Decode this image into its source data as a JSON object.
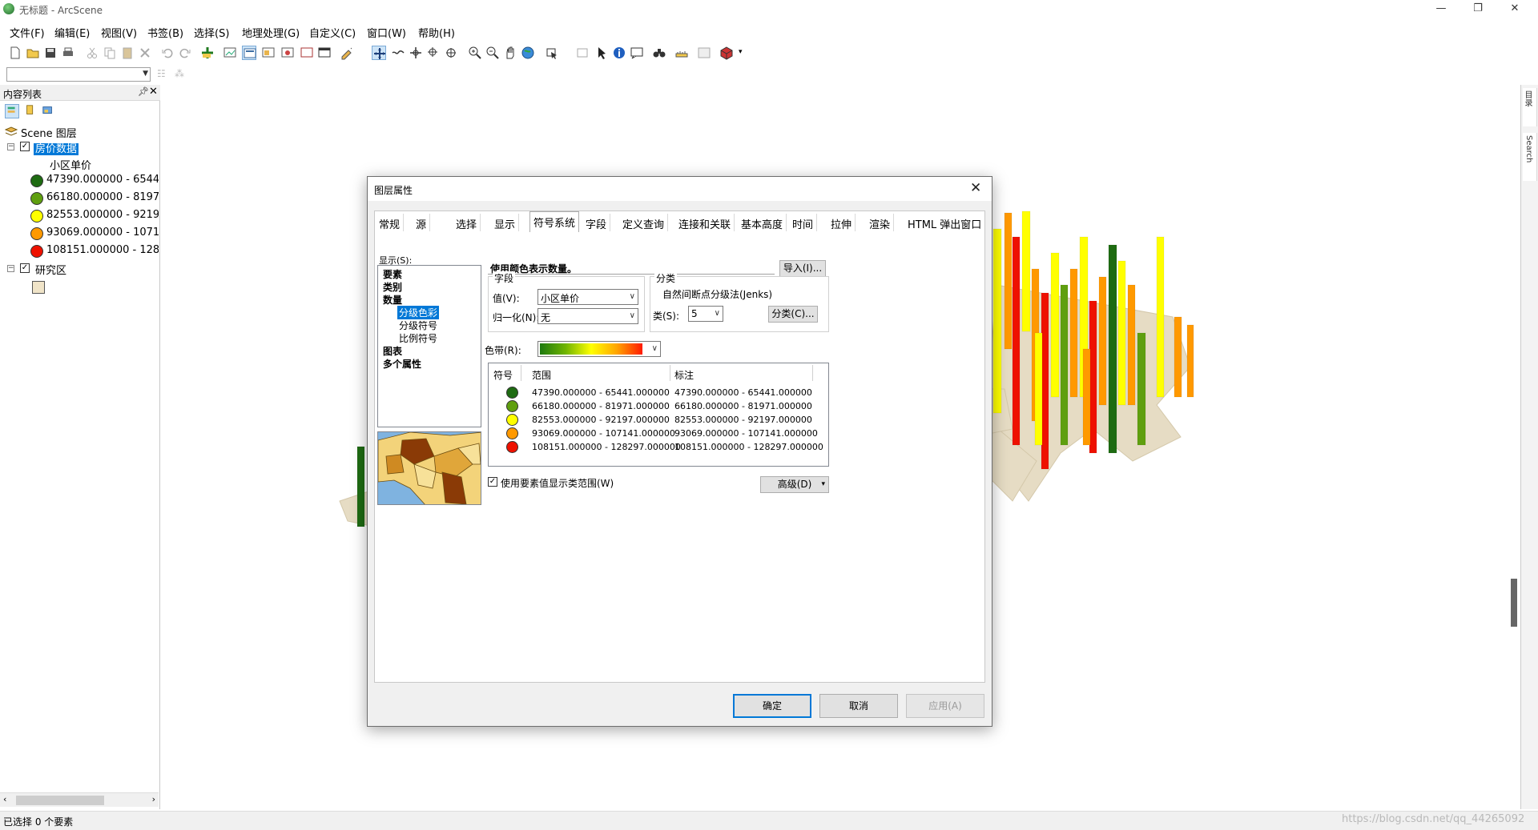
{
  "window": {
    "title": "无标题 - ArcScene"
  },
  "menu": [
    "文件(F)",
    "编辑(E)",
    "视图(V)",
    "书签(B)",
    "选择(S)",
    "地理处理(G)",
    "自定义(C)",
    "窗口(W)",
    "帮助(H)"
  ],
  "toc": {
    "title": "内容列表",
    "scene_layers": "Scene 图层",
    "layer1": {
      "name": "房价数据",
      "field": "小区单价",
      "classes": [
        {
          "label": "47390.000000 - 6544",
          "color": "#1e6b12"
        },
        {
          "label": "66180.000000 - 8197",
          "color": "#5f9f0f"
        },
        {
          "label": "82553.000000 - 9219",
          "color": "#ffff00"
        },
        {
          "label": "93069.000000 - 1071",
          "color": "#ff9900"
        },
        {
          "label": "108151.000000 - 128",
          "color": "#ee1100"
        }
      ]
    },
    "layer2": {
      "name": "研究区",
      "color": "#f0e4c8"
    }
  },
  "status": {
    "text": "已选择 0 个要素",
    "watermark": "https://blog.csdn.net/qq_44265092"
  },
  "rdock": {
    "tab1": "目录",
    "tab2": "Search"
  },
  "dialog": {
    "title": "图层属性",
    "tabs": [
      "常规",
      "源",
      "选择",
      "显示",
      "符号系统",
      "字段",
      "定义查询",
      "连接和关联",
      "基本高度",
      "时间",
      "拉伸",
      "渲染",
      "HTML 弹出窗口"
    ],
    "active_tab": "符号系统",
    "show_label": "显示(S):",
    "show_items": {
      "features": "要素",
      "categories": "类别",
      "quantities": "数量",
      "graduated_colors": "分级色彩",
      "graduated_symbols": "分级符号",
      "proportional_symbols": "比例符号",
      "charts": "图表",
      "multiple_attributes": "多个属性"
    },
    "draw_header": "使用颜色表示数量。",
    "import_label": "导入(I)...",
    "fields_group": "字段",
    "value_label": "值(V):",
    "value": "小区单价",
    "normalize_label": "归一化(N):",
    "normalize": "无",
    "class_group": "分类",
    "class_method": "自然间断点分级法(Jenks)",
    "classes_label": "类(S):",
    "classes_count": "5",
    "classify_label": "分类(C)...",
    "ramp_label": "色带(R):",
    "table_headers": {
      "symbol": "符号",
      "range": "范围",
      "label": "标注"
    },
    "rows": [
      {
        "range": "47390.000000 - 65441.000000",
        "label": "47390.000000 - 65441.000000",
        "color": "#1e6b12"
      },
      {
        "range": "66180.000000 - 81971.000000",
        "label": "66180.000000 - 81971.000000",
        "color": "#5f9f0f"
      },
      {
        "range": "82553.000000 - 92197.000000",
        "label": "82553.000000 - 92197.000000",
        "color": "#ffff00"
      },
      {
        "range": "93069.000000 - 107141.000000",
        "label": "93069.000000 - 107141.000000",
        "color": "#ff9900"
      },
      {
        "range": "108151.000000 - 128297.000000",
        "label": "108151.000000 - 128297.000000",
        "color": "#ee1100"
      }
    ],
    "use_range_label": "使用要素值显示类范围(W)",
    "advanced_label": "高级(D)",
    "ok_label": "确定",
    "cancel_label": "取消",
    "apply_label": "应用(A)"
  }
}
